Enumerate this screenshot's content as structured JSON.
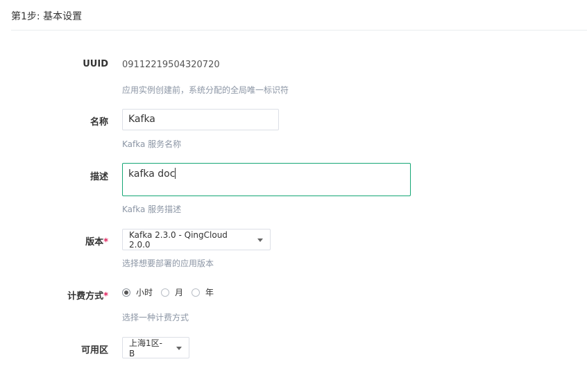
{
  "step": {
    "title": "第1步: 基本设置"
  },
  "form": {
    "uuid": {
      "label": "UUID",
      "value": "09112219504320720",
      "help": "应用实例创建前，系统分配的全局唯一标识符"
    },
    "name": {
      "label": "名称",
      "value": "Kafka",
      "help": "Kafka 服务名称"
    },
    "description": {
      "label": "描述",
      "value": "kafka doc",
      "help": "Kafka 服务描述"
    },
    "version": {
      "label": "版本",
      "required_mark": "*",
      "selected": "Kafka 2.3.0 - QingCloud 2.0.0",
      "help": "选择想要部署的应用版本"
    },
    "billing": {
      "label": "计费方式",
      "required_mark": "*",
      "options": [
        "小时",
        "月",
        "年"
      ],
      "selected": "小时",
      "help": "选择一种计费方式"
    },
    "zone": {
      "label": "可用区",
      "selected": "上海1区-B"
    }
  },
  "colors": {
    "focus_border": "#15a675",
    "required": "#e0245e",
    "help_text": "#8c96a5"
  }
}
